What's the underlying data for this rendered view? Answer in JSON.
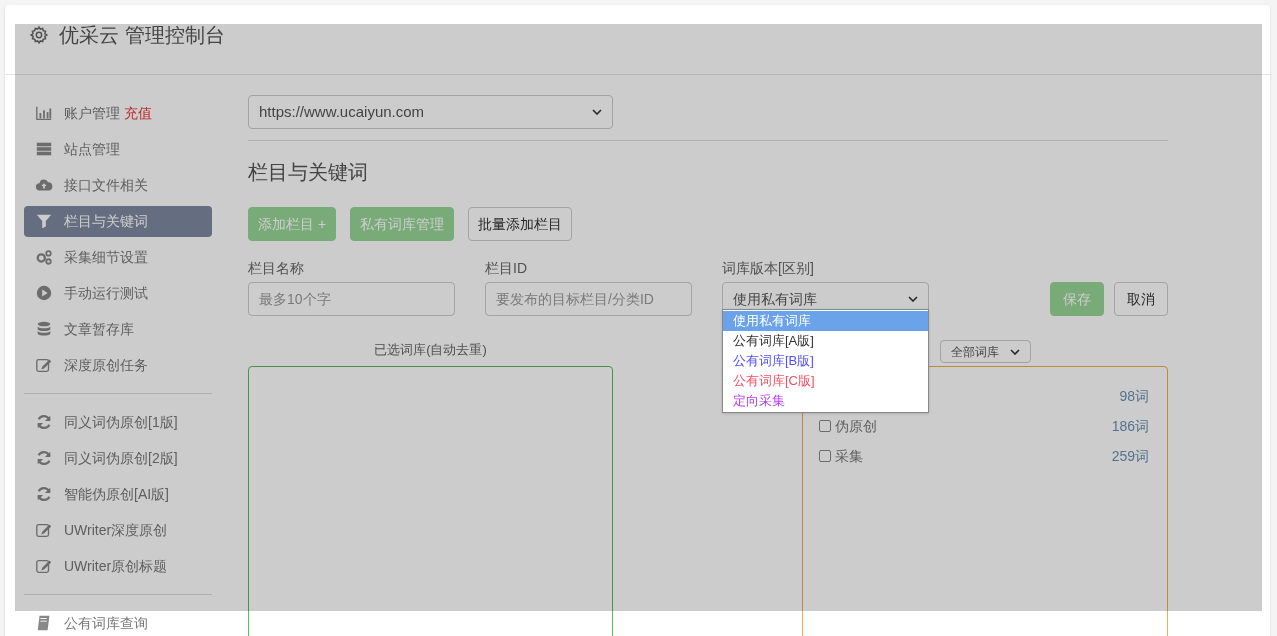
{
  "header": {
    "title": "优采云 管理控制台"
  },
  "sidebar": {
    "groups": [
      [
        {
          "label": "账户管理",
          "badge": "充值",
          "selected": false
        },
        {
          "label": "站点管理",
          "selected": false
        },
        {
          "label": "接口文件相关",
          "selected": false
        },
        {
          "label": "栏目与关键词",
          "selected": true
        },
        {
          "label": "采集细节设置",
          "selected": false
        },
        {
          "label": "手动运行测试",
          "selected": false
        },
        {
          "label": "文章暂存库",
          "selected": false
        },
        {
          "label": "深度原创任务",
          "selected": false
        }
      ],
      [
        {
          "label": "同义词伪原创[1版]",
          "selected": false
        },
        {
          "label": "同义词伪原创[2版]",
          "selected": false
        },
        {
          "label": "智能伪原创[AI版]",
          "selected": false
        },
        {
          "label": "UWriter深度原创",
          "selected": false
        },
        {
          "label": "UWriter原创标题",
          "selected": false
        }
      ],
      [
        {
          "label": "公有词库查询",
          "selected": false
        }
      ]
    ]
  },
  "site_select": {
    "value": "https://www.ucaiyun.com"
  },
  "section_title": "栏目与关键词",
  "buttons": [
    {
      "label": "添加栏目 +",
      "kind": "primary"
    },
    {
      "label": "私有词库管理",
      "kind": "primary"
    },
    {
      "label": "批量添加栏目",
      "kind": "default"
    }
  ],
  "form": {
    "name": {
      "label": "栏目名称",
      "placeholder": "最多10个字"
    },
    "id": {
      "label": "栏目ID",
      "placeholder": "要发布的目标栏目/分类ID"
    },
    "version": {
      "label": "词库版本[区别]",
      "value": "使用私有词库",
      "expanded": true,
      "options": [
        {
          "label": "使用私有词库",
          "selected": true
        },
        {
          "label": "公有词库[A版]",
          "selected": false,
          "color": "#333333"
        },
        {
          "label": "公有词库[B版]",
          "selected": false,
          "color": "#5050ff"
        },
        {
          "label": "公有词库[C版]",
          "selected": false,
          "color": "#f05064"
        },
        {
          "label": "定向采集",
          "selected": false,
          "color": "#b43cf0"
        }
      ]
    },
    "save": "保存",
    "cancel": "取消"
  },
  "selected_panel": {
    "title": "已选词库(自动去重)"
  },
  "library_panel": {
    "filter": "全部词库",
    "rows": [
      {
        "count": "98词"
      },
      {
        "label": "伪原创",
        "count": "186词",
        "checked": false
      },
      {
        "label": "采集",
        "count": "259词",
        "checked": false
      }
    ]
  }
}
